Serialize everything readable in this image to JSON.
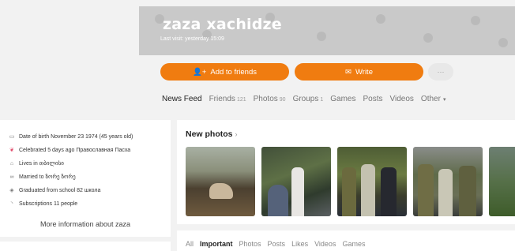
{
  "profile": {
    "name": "zaza xachidze",
    "last_visit": "Last visit: yesterday 15:09"
  },
  "actions": {
    "add_friends": "Add to friends",
    "write": "Write",
    "more": "···"
  },
  "tabs": [
    {
      "label": "News Feed",
      "count": ""
    },
    {
      "label": "Friends",
      "count": "121"
    },
    {
      "label": "Photos",
      "count": "90"
    },
    {
      "label": "Groups",
      "count": "1"
    },
    {
      "label": "Games",
      "count": ""
    },
    {
      "label": "Posts",
      "count": ""
    },
    {
      "label": "Videos",
      "count": ""
    },
    {
      "label": "Other",
      "count": ""
    }
  ],
  "info": {
    "birth": "Date of birth November 23 1974 (45 years old)",
    "celebrated": "Celebrated 5 days ago Православная Пасха",
    "lives": "Lives in თბილისი",
    "married": "Married to ზორე ზორე",
    "graduated": "Graduated from school 82 школа",
    "subscriptions": "Subscriptions 11 people",
    "more": "More information about zaza"
  },
  "photos": {
    "title": "New photos",
    "chevron": "›"
  },
  "feed_tabs": [
    "All",
    "Important",
    "Photos",
    "Posts",
    "Likes",
    "Videos",
    "Games"
  ],
  "colors": {
    "accent": "#f07c10",
    "cover": "#c9c9c9"
  }
}
